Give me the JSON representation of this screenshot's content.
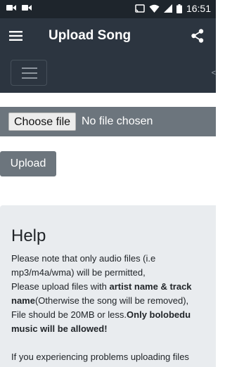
{
  "status_bar": {
    "time": "16:51",
    "left_icons": [
      "video-camera-icon",
      "video-camera-icon"
    ],
    "right_icons": [
      "cast-icon",
      "wifi-icon",
      "signal-icon",
      "battery-icon"
    ]
  },
  "app_bar": {
    "title": "Upload Song",
    "menu_icon": "hamburger-menu-icon",
    "share_icon": "share-icon"
  },
  "nav": {
    "edge_mark": "<"
  },
  "file_input": {
    "button_label": "Choose file",
    "status": "No file chosen"
  },
  "upload": {
    "label": "Upload"
  },
  "help": {
    "title": "Help",
    "line1": "Please note that only audio files (i.e mp3/m4a/wma) will be permitted,",
    "line2_prefix": "Please upload files with ",
    "line2_bold": "artist name & track name",
    "line2_suffix": "(Otherwise the song will be removed),",
    "line3_prefix": "File should be 20MB or less.",
    "line3_bold": "Only bolobedu music will be allowed!",
    "more": "If you experiencing problems uploading files"
  },
  "colors": {
    "status_bar": "#1e252c",
    "app_bar": "#2c3540",
    "secondary": "#6c757d",
    "help_bg": "#e9ecef"
  }
}
